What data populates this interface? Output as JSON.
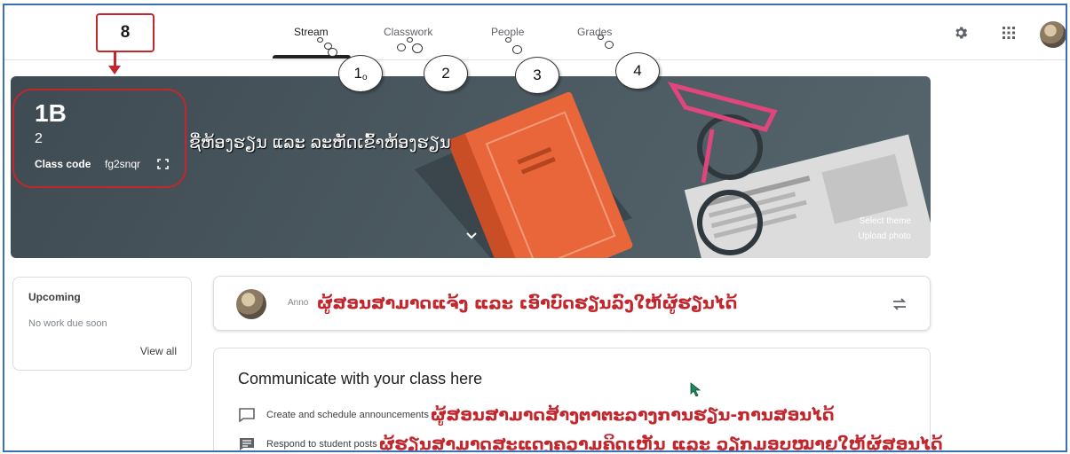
{
  "tabs": [
    {
      "label": "Stream"
    },
    {
      "label": "Classwork"
    },
    {
      "label": "People"
    },
    {
      "label": "Grades"
    }
  ],
  "annotations": {
    "bubble1": "1",
    "bubble1_sub": "o",
    "bubble2": "2",
    "bubble3": "3",
    "bubble4": "4",
    "callout": "8",
    "banner_note": "ຊື່ຫ້ອງຮຽນ ແລະ ລະຫັດເຂົ້າຫ້ອງຮຽນ",
    "announce_note": "ຜູ້ສອນສາມາດແຈ້ງ ແລະ ເອົາບົດຮຽນລົງໃຫ້ຜູ້ຮຽນໄດ້",
    "schedule_note": "ຜູ້ສອນສາມາດສ້າງຕາຕະລາງການຮຽນ-ການສອນໄດ້",
    "respond_note": "ຜູ້ຮຽນສາມາດສະແດງຄວາມຄິດເຫັນ ແລະ ວຽກມອບໝາຍໃຫ້ຜູ້ສອນໄດ້"
  },
  "banner": {
    "class_name": "1B",
    "section": "2",
    "class_code_label": "Class code",
    "class_code": "fg2snqr",
    "select_theme": "Select theme",
    "upload_photo": "Upload photo"
  },
  "upcoming": {
    "title": "Upcoming",
    "empty": "No work due soon",
    "view_all": "View all"
  },
  "announce": {
    "placeholder": "Anno"
  },
  "communicate": {
    "title": "Communicate with your class here",
    "row1": "Create and schedule announcements",
    "row2": "Respond to student posts"
  },
  "colors": {
    "annotation_red": "#c1272d",
    "frame_blue": "#3b6fb6",
    "banner_bg": "#4c5a62",
    "book_orange": "#e8663a"
  },
  "icons": [
    "gear-icon",
    "apps-grid-icon",
    "user-avatar",
    "fullscreen-icon",
    "chevron-down-icon",
    "repost-icon",
    "chat-bubble-icon",
    "comment-icon",
    "mouse-cursor-icon"
  ]
}
